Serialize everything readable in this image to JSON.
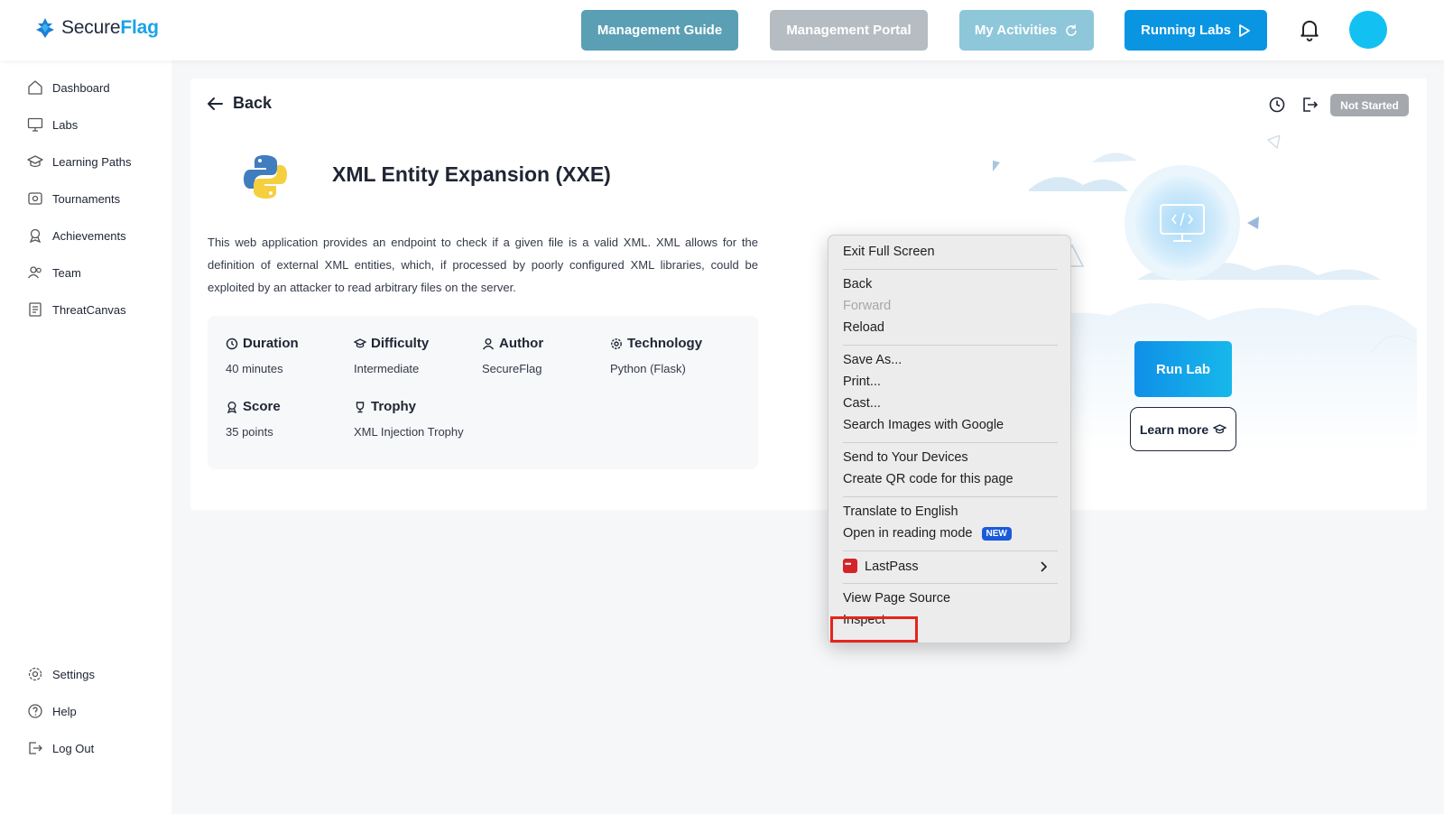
{
  "brand": {
    "name_part1": "Secure",
    "name_part2": "Flag"
  },
  "header": {
    "buttons": [
      {
        "label": "Management Guide"
      },
      {
        "label": "Management Portal"
      },
      {
        "label": "My Activities"
      },
      {
        "label": "Running Labs"
      }
    ]
  },
  "sidebar": {
    "items": [
      {
        "label": "Dashboard"
      },
      {
        "label": "Labs"
      },
      {
        "label": "Learning Paths"
      },
      {
        "label": "Tournaments"
      },
      {
        "label": "Achievements"
      },
      {
        "label": "Team"
      },
      {
        "label": "ThreatCanvas"
      }
    ],
    "bottom": [
      {
        "label": "Settings"
      },
      {
        "label": "Help"
      },
      {
        "label": "Log Out"
      }
    ]
  },
  "lab": {
    "back_label": "Back",
    "title": "XML Entity Expansion (XXE)",
    "description": "This web application provides an endpoint to check if a given file is a valid XML. XML allows for the definition of external XML entities, which, if processed by poorly configured XML libraries, could be exploited by an attacker to read arbitrary files on the server.",
    "status": "Not Started",
    "info": {
      "duration": {
        "label": "Duration",
        "value": "40 minutes"
      },
      "difficulty": {
        "label": "Difficulty",
        "value": "Intermediate"
      },
      "author": {
        "label": "Author",
        "value": "SecureFlag"
      },
      "technology": {
        "label": "Technology",
        "value": "Python (Flask)"
      },
      "score": {
        "label": "Score",
        "value": "35 points"
      },
      "trophy": {
        "label": "Trophy",
        "value": "XML Injection Trophy"
      }
    },
    "run_label": "Run Lab",
    "learn_label": "Learn more"
  },
  "context_menu": {
    "items": {
      "exit_fullscreen": "Exit Full Screen",
      "back": "Back",
      "forward": "Forward",
      "reload": "Reload",
      "save_as": "Save As...",
      "print": "Print...",
      "cast": "Cast...",
      "search_images": "Search Images with Google",
      "send_devices": "Send to Your Devices",
      "qr_code": "Create QR code for this page",
      "translate": "Translate to English",
      "reading_mode": "Open in reading mode",
      "new_badge": "NEW",
      "lastpass": "LastPass",
      "view_source": "View Page Source",
      "inspect": "Inspect"
    }
  }
}
